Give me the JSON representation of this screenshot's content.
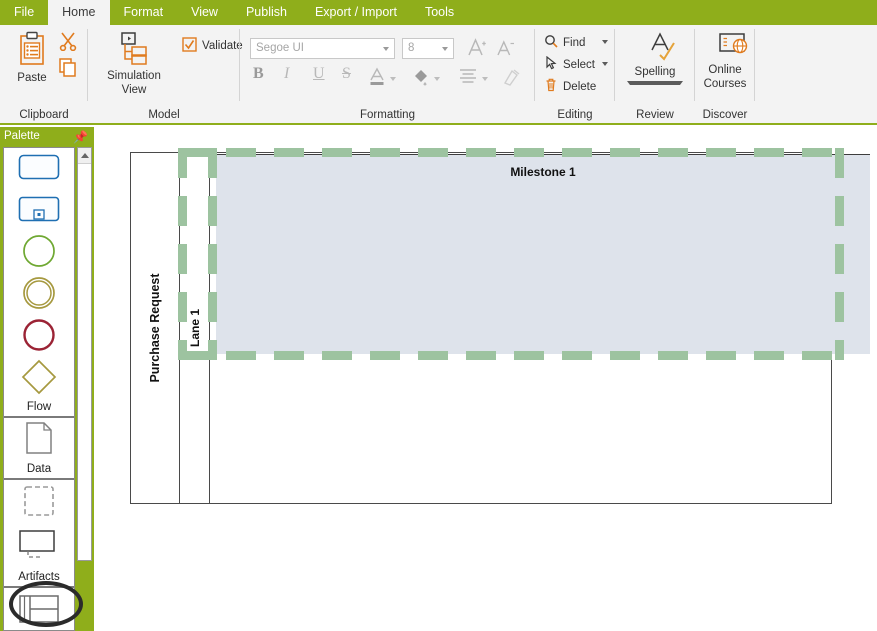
{
  "app": {
    "tabs": [
      {
        "label": "File",
        "active": false
      },
      {
        "label": "Home",
        "active": true
      },
      {
        "label": "Format",
        "active": false
      },
      {
        "label": "View",
        "active": false
      },
      {
        "label": "Publish",
        "active": false
      },
      {
        "label": "Export / Import",
        "active": false
      },
      {
        "label": "Tools",
        "active": false
      }
    ]
  },
  "ribbon": {
    "clipboard": {
      "group_label": "Clipboard",
      "paste_label": "Paste",
      "paste_icon": "clipboard-icon",
      "cut_icon": "scissors-icon",
      "copy_icon": "copy-icon"
    },
    "model": {
      "group_label": "Model",
      "simulation_label": "Simulation",
      "simulation_label2": "View",
      "simulation_icon": "hierarchy-icon",
      "validate_label": "Validate",
      "validate_icon": "checkbox-check-icon"
    },
    "formatting": {
      "group_label": "Formatting",
      "font_name": "Segoe UI",
      "font_size": "8",
      "grow_font_icon": "grow-font-icon",
      "shrink_font_icon": "shrink-font-icon",
      "bold_label": "B",
      "italic_label": "I",
      "underline_label": "U",
      "strike_label": "S",
      "font_color_icon": "font-color-icon",
      "fill_color_icon": "fill-color-icon",
      "align_icon": "align-icon",
      "format_painter_icon": "format-painter-icon"
    },
    "editing": {
      "group_label": "Editing",
      "find_label": "Find",
      "find_icon": "search-icon",
      "select_label": "Select",
      "select_icon": "cursor-select-icon",
      "delete_label": "Delete",
      "delete_icon": "trash-icon"
    },
    "review": {
      "group_label": "Review",
      "spelling_label": "Spelling",
      "spelling_icon": "spell-check-icon"
    },
    "discover": {
      "group_label": "Discover",
      "online_label": "Online",
      "courses_label": "Courses",
      "online_courses_icon": "online-courses-icon"
    }
  },
  "palette": {
    "title": "Palette",
    "pin_icon": "pin-icon",
    "sections": [
      {
        "name": "Flow",
        "shapes": [
          {
            "icon": "task-rectangle-icon",
            "color": "#1F6FB2"
          },
          {
            "icon": "subprocess-rectangle-icon",
            "color": "#1F6FB2"
          },
          {
            "icon": "start-event-circle-icon",
            "color": "#6FA832"
          },
          {
            "icon": "intermediate-event-circle-icon",
            "color": "#A6993F"
          },
          {
            "icon": "end-event-circle-icon",
            "color": "#9B2335"
          },
          {
            "icon": "gateway-diamond-icon",
            "color": "#A6993F"
          }
        ]
      },
      {
        "name": "Data",
        "shapes": [
          {
            "icon": "data-object-document-icon",
            "color": "#808080"
          }
        ]
      },
      {
        "name": "Artifacts",
        "shapes": [
          {
            "icon": "group-dashed-box-icon",
            "color": "#808080"
          },
          {
            "icon": "text-annotation-icon",
            "color": "#3d3d3d"
          }
        ]
      }
    ],
    "pool_tool": {
      "icon": "pool-lanes-icon",
      "highlighted": true
    },
    "scrollbar_up_icon": "scroll-up-arrow-icon"
  },
  "canvas": {
    "pool_name": "Purchase Request",
    "lane_name": "Lane 1",
    "milestone_name": "Milestone 1",
    "selection_color": "#9DC3A0",
    "milestone_fill": "#DEE3EB",
    "resize_handle_icon": "chevron-right-handle-icon"
  }
}
